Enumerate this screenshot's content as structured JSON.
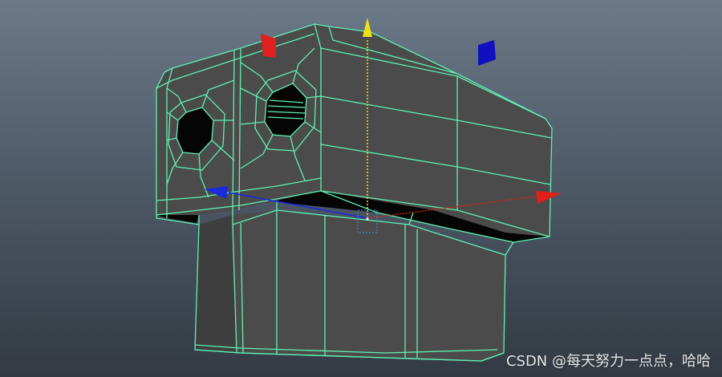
{
  "viewport": {
    "background_top": "#6b7988",
    "background_bottom": "#333a43",
    "mesh_fill": "#4b4b4b",
    "mesh_fill_dark": "#3e3e3e",
    "wireframe_color": "#5ff0b4",
    "hole_fill": "#050505"
  },
  "manipulator": {
    "icon": "move-tool-gizmo-icon",
    "x_axis_color": "#e0201a",
    "y_axis_color": "#f0e010",
    "z_axis_color": "#1a2ae0",
    "plane_handle_xy_color": "#e02020",
    "plane_handle_yz_color": "#1010c0",
    "pivot_color": "#3a9ad0"
  },
  "watermark": {
    "text": "CSDN @每天努力一点点，哈哈"
  }
}
